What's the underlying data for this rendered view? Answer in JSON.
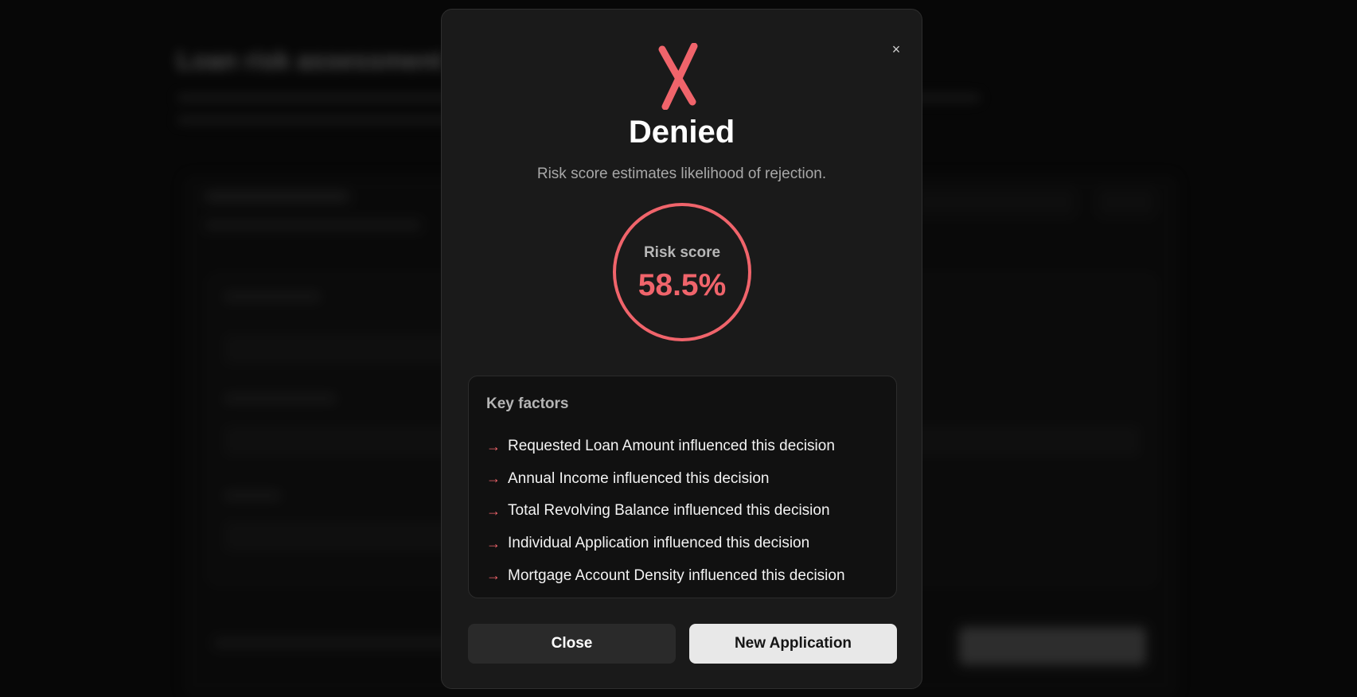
{
  "background": {
    "page_title": "Loan risk assessment"
  },
  "modal": {
    "close_symbol": "×",
    "status_icon": "x-mark-icon",
    "status_title": "Denied",
    "status_subtitle": "Risk score estimates likelihood of rejection.",
    "score": {
      "label": "Risk score",
      "value": "58.5%",
      "color": "#f0646b"
    },
    "factors": {
      "title": "Key factors",
      "arrow": "→",
      "items": [
        "Requested Loan Amount influenced this decision",
        "Annual Income influenced this decision",
        "Total Revolving Balance influenced this decision",
        "Individual Application influenced this decision",
        "Mortgage Account Density influenced this decision"
      ]
    },
    "buttons": {
      "close_label": "Close",
      "new_label": "New Application"
    }
  },
  "colors": {
    "accent_denied": "#f0646b",
    "modal_bg": "#1a1a1a",
    "primary_button_bg": "#e8e8e8"
  }
}
